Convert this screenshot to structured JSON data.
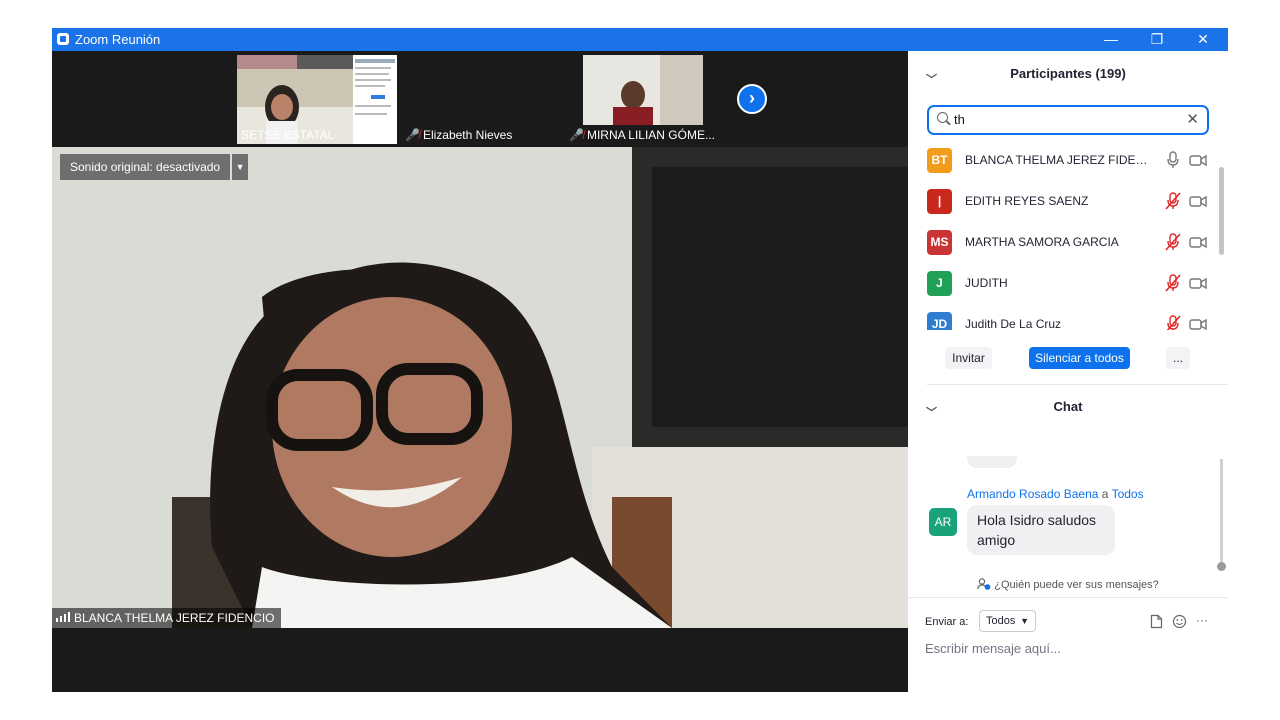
{
  "window": {
    "title": "Zoom Reunión",
    "controls": {
      "minimize": "—",
      "restore": "❐",
      "close": "✕"
    }
  },
  "thumbnails": [
    {
      "name": "SETSE ESTATAL",
      "muted": false
    },
    {
      "name": "Elizabeth Nieves",
      "muted": true
    },
    {
      "name": "MIRNA LILIAN GÓME...",
      "muted": true
    }
  ],
  "next_page_glyph": "›",
  "main_video": {
    "sound_button": "Sonido original: desactivado",
    "speaker_name": "BLANCA THELMA JEREZ FIDENCIO"
  },
  "participants": {
    "title": "Participantes (199)",
    "search_value": "th",
    "list": [
      {
        "initials": "BT",
        "color": "#f29b1c",
        "name": "BLANCA THELMA JEREZ FIDENC...",
        "mic": "on",
        "video": "off"
      },
      {
        "initials": "|",
        "color": "#c9291d",
        "name": "EDITH REYES SAENZ",
        "mic": "muted",
        "video": "off"
      },
      {
        "initials": "MS",
        "color": "#c93434",
        "name": "MARTHA SAMORA GARCIA",
        "mic": "muted",
        "video": "off"
      },
      {
        "initials": "J",
        "color": "#21a157",
        "name": "JUDITH",
        "mic": "muted",
        "video": "off"
      },
      {
        "initials": "JD",
        "color": "#2f7dd1",
        "name": "Judith De La Cruz",
        "mic": "muted",
        "video": "off"
      }
    ],
    "buttons": {
      "invite": "Invitar",
      "mute_all": "Silenciar a todos",
      "more": "..."
    }
  },
  "chat": {
    "title": "Chat",
    "message": {
      "sender": "Armando Rosado Baena",
      "to_word": "a",
      "recipient": "Todos",
      "avatar": "AR",
      "text": "Hola Isidro saludos amigo"
    },
    "who_can_see": "¿Quién puede ver sus mensajes?",
    "send_to_label": "Enviar a:",
    "send_to_value": "Todos",
    "placeholder": "Escribir mensaje aquí...",
    "more": "···"
  }
}
